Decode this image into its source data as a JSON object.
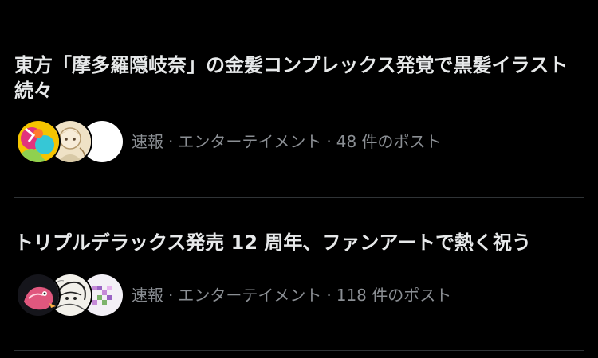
{
  "trends": [
    {
      "title": "東方「摩多羅隠岐奈」の金髪コンプレックス発覚で黒髪イラスト続々",
      "category": "速報",
      "topic": "エンターテイメント",
      "posts": "48 件のポスト",
      "avatars": [
        "colorful-illustration-avatar",
        "beige-character-avatar",
        "white-blank-avatar"
      ]
    },
    {
      "title": "トリプルデラックス発売 12 周年、ファンアートで熱く祝う",
      "category": "速報",
      "topic": "エンターテイメント",
      "posts": "118 件のポスト",
      "avatars": [
        "dark-pink-creature-avatar",
        "sketch-character-avatar",
        "pixel-art-avatar"
      ]
    }
  ],
  "separator": "·",
  "colors": {
    "background": "#000000",
    "title_text": "#e7e9ea",
    "meta_text": "#8b8f94",
    "divider": "#2f3336"
  }
}
